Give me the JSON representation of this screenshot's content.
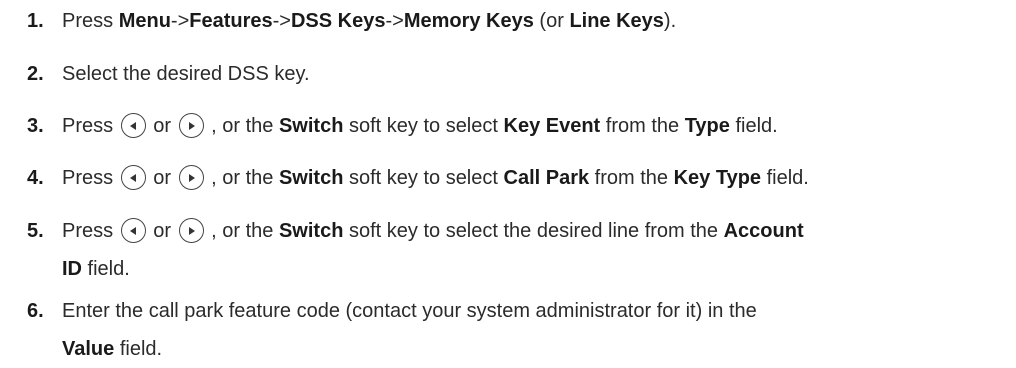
{
  "steps": [
    {
      "number": "1.",
      "parts": {
        "t1": "Press ",
        "b1": "Menu",
        "t2": "->",
        "b2": "Features",
        "t3": "->",
        "b3": "DSS Keys",
        "t4": "->",
        "b4": "Memory Keys",
        "t5": " (or ",
        "b5": "Line Keys",
        "t6": ")."
      }
    },
    {
      "number": "2.",
      "parts": {
        "t1": "Select the desired DSS key."
      }
    },
    {
      "number": "3.",
      "parts": {
        "t1": "Press ",
        "or": " or ",
        "t2": " , or the ",
        "b1": "Switch",
        "t3": " soft key to select ",
        "b2": "Key Event",
        "t4": " from the ",
        "b3": "Type",
        "t5": " field."
      }
    },
    {
      "number": "4.",
      "parts": {
        "t1": "Press ",
        "or": " or ",
        "t2": " , or the ",
        "b1": "Switch",
        "t3": " soft key to select ",
        "b2": "Call Park",
        "t4": " from the ",
        "b3": "Key Type",
        "t5": " field."
      }
    },
    {
      "number": "5.",
      "parts": {
        "t1": "Press ",
        "or": " or ",
        "t2": " , or the ",
        "b1": "Switch",
        "t3": " soft key to select the desired line from the ",
        "b2": "Account",
        "b3": "ID",
        "t4": " field."
      }
    },
    {
      "number": "6.",
      "parts": {
        "t1": "Enter the call park feature code (contact your system administrator for it) in the",
        "b1": "Value",
        "t2": " field."
      }
    }
  ],
  "icons": [
    "left-navigation-key-icon",
    "right-navigation-key-icon"
  ]
}
